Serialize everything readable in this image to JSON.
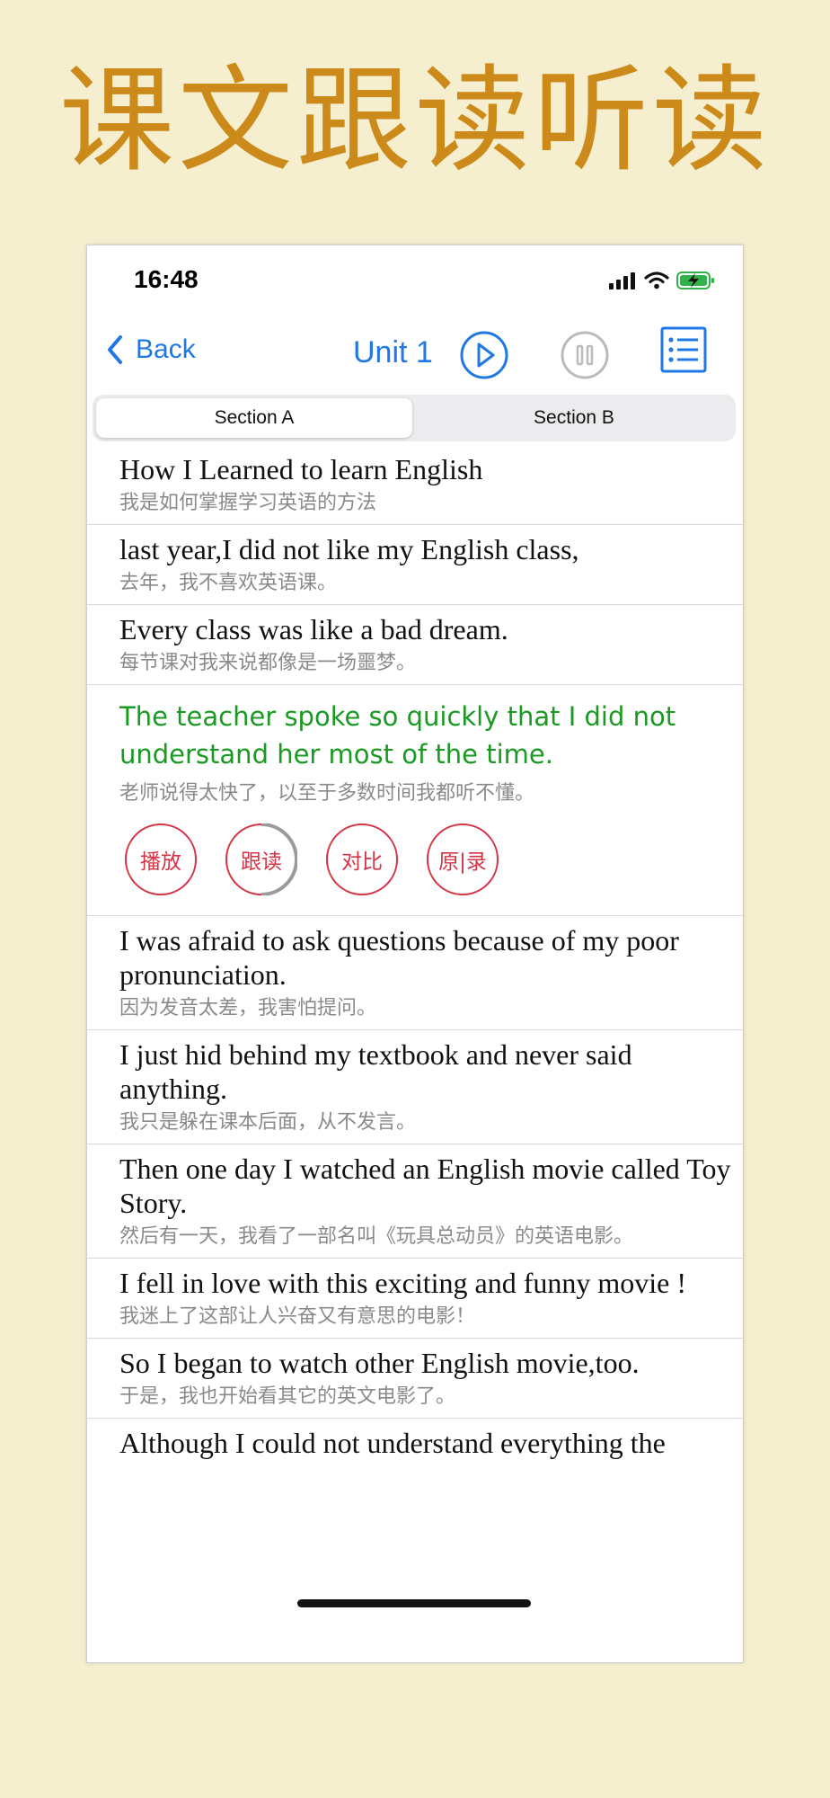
{
  "banner": {
    "title": "课文跟读听读"
  },
  "status_bar": {
    "time": "16:48"
  },
  "navbar": {
    "back_label": "Back",
    "title": "Unit 1"
  },
  "tabs": [
    {
      "label": "Section A",
      "selected": true
    },
    {
      "label": "Section B",
      "selected": false
    }
  ],
  "sentences": [
    {
      "en": "How I Learned to learn English",
      "zh": "我是如何掌握学习英语的方法"
    },
    {
      "en": "last year,I did not like my English class,",
      "zh": "去年，我不喜欢英语课。"
    },
    {
      "en": "Every class was like a bad dream.",
      "zh": "每节课对我来说都像是一场噩梦。"
    },
    {
      "en": "The teacher spoke so quickly that I did not understand her most of the time.",
      "zh": "老师说得太快了，以至于多数时间我都听不懂。",
      "active": true
    },
    {
      "en": "I was afraid to ask questions because of my poor pronunciation.",
      "zh": "因为发音太差，我害怕提问。"
    },
    {
      "en": "I just hid behind my textbook and never said anything.",
      "zh": "我只是躲在课本后面，从不发言。"
    },
    {
      "en": "Then one day I watched an English movie called Toy Story.",
      "zh": "然后有一天，我看了一部名叫《玩具总动员》的英语电影。"
    },
    {
      "en": "I fell in love with this exciting and funny movie !",
      "zh": "我迷上了这部让人兴奋又有意思的电影！"
    },
    {
      "en": "So I began to watch other English movie,too.",
      "zh": "于是，我也开始看其它的英文电影了。"
    },
    {
      "en": "Although I could not understand everything the",
      "zh": ""
    }
  ],
  "controls": {
    "play": "播放",
    "follow": "跟读",
    "compare": "对比",
    "original_record": "原|录"
  },
  "colors": {
    "accent": "#1f78e6",
    "active_sentence": "#1a9a22",
    "control_red": "#d63445",
    "banner": "#cc8a1a",
    "background": "#f6efcf"
  }
}
